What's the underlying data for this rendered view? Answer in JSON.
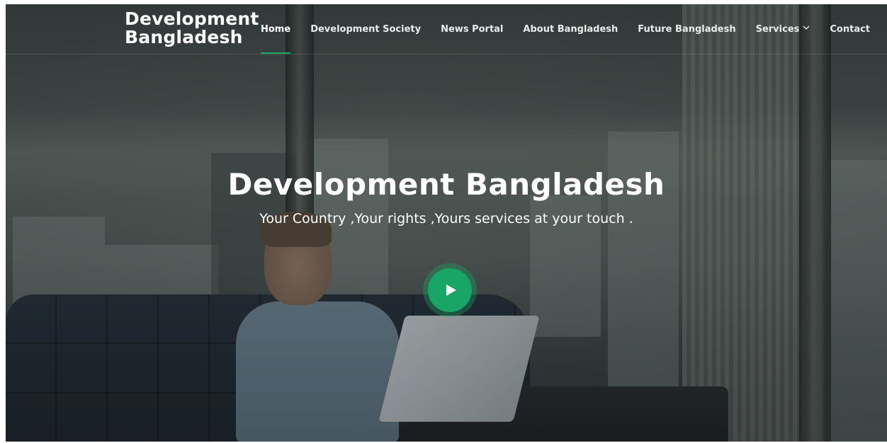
{
  "brand": {
    "line1": "Development",
    "line2": "Bangladesh"
  },
  "nav": {
    "items": [
      {
        "label": "Home",
        "active": true
      },
      {
        "label": "Development Society",
        "active": false
      },
      {
        "label": "News Portal",
        "active": false
      },
      {
        "label": "About Bangladesh",
        "active": false
      },
      {
        "label": "Future Bangladesh",
        "active": false
      },
      {
        "label": "Services",
        "active": false,
        "icon": "chevron-down-icon"
      },
      {
        "label": "Contact",
        "active": false
      }
    ]
  },
  "hero": {
    "title": "Development Bangladesh",
    "subtitle": "Your Country ,Your rights ,Yours services at your touch .",
    "play_icon": "play-icon"
  },
  "colors": {
    "accent": "#19a566",
    "text": "#ffffff"
  }
}
